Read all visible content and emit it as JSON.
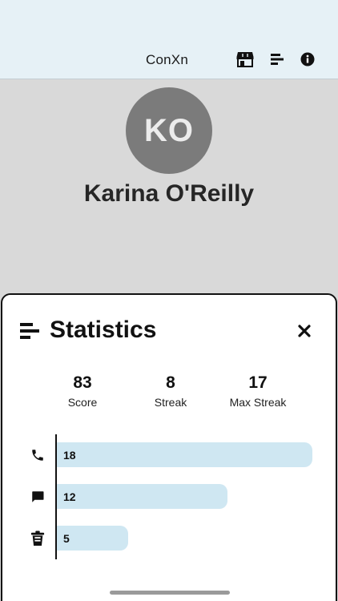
{
  "header": {
    "title": "ConXn",
    "icons": [
      "store-icon",
      "stats-icon",
      "info-icon"
    ]
  },
  "profile": {
    "initials": "KO",
    "name": "Karina O'Reilly",
    "avatar_color": "#7b7b7b"
  },
  "statistics": {
    "title": "Statistics",
    "summary": [
      {
        "value": "83",
        "label": "Score"
      },
      {
        "value": "8",
        "label": "Streak"
      },
      {
        "value": "17",
        "label": "Max Streak"
      }
    ],
    "chart_data": {
      "type": "bar",
      "orientation": "horizontal",
      "categories": [
        "phone-icon",
        "message-icon",
        "trash-icon"
      ],
      "values": [
        18,
        12,
        5
      ],
      "xlim": [
        0,
        18
      ],
      "bar_color": "#cfe7f2"
    }
  }
}
